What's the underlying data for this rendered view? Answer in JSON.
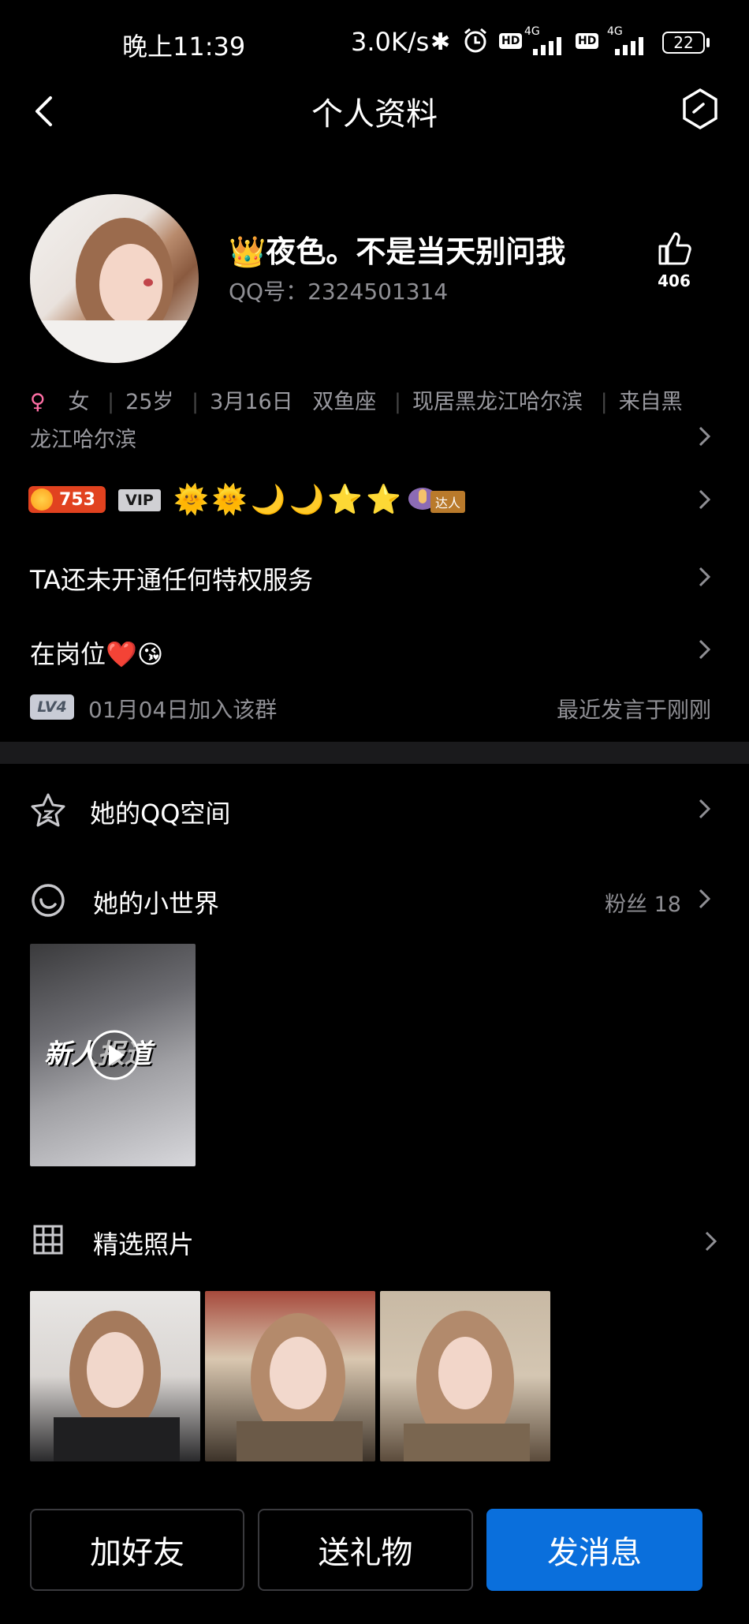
{
  "status_bar": {
    "time": "晚上11:39",
    "speed": "3.0K/s",
    "hd1": "HD",
    "net1": "4G",
    "hd2": "HD",
    "net2": "4G",
    "battery": "22"
  },
  "header": {
    "title": "个人资料"
  },
  "profile": {
    "name": "👑夜色。不是当天别问我",
    "qq": "QQ号：2324501314",
    "likes": "406",
    "gender_symbol": "♀",
    "gender": "女",
    "age": "25岁",
    "birthday": "3月16日",
    "zodiac": "双鱼座",
    "location": "现居黑龙江哈尔滨",
    "hometown_line1": "来自黑",
    "hometown_line2": "龙江哈尔滨",
    "level_points": "753",
    "vip": "VIP",
    "talent": "达人",
    "privilege": "TA还未开通任何特权服务",
    "signature": "在岗位❤️😘",
    "group_level": "LV4",
    "join_date": "01月04日加入该群",
    "last_speak": "最近发言于刚刚"
  },
  "sections": {
    "qzone": "她的QQ空间",
    "world": "她的小世界",
    "world_fans": "粉丝 18",
    "world_video_title": "新人报道",
    "photos": "精选照片"
  },
  "buttons": {
    "add_friend": "加好友",
    "gift": "送礼物",
    "message": "发消息"
  },
  "colors": {
    "background": "#000000",
    "primary": "#0a6fdc",
    "muted": "#8f8f94",
    "gender_pink": "#ff6fa5"
  }
}
